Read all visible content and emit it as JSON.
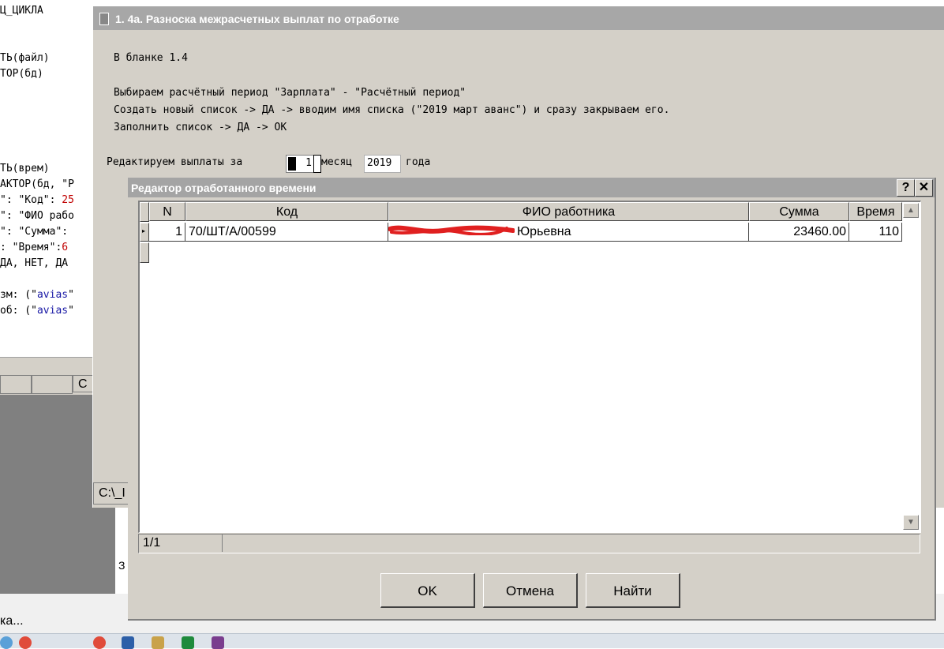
{
  "background_editor": {
    "lines": [
      {
        "text": "Ц_ЦИКЛА"
      },
      {
        "text": "ТЬ(файл)"
      },
      {
        "text": "ТОР(бд)"
      },
      {
        "text": "ТЬ(врем)"
      },
      {
        "text": "АКТОР(бд, \"Р"
      },
      {
        "text": "\": \"Код\": ",
        "red": "25"
      },
      {
        "text": "\": \"ФИО рабо"
      },
      {
        "text": "\": \"Сумма\":"
      },
      {
        "text": ": \"Время\":",
        "red": "6"
      },
      {
        "text": "ДА, НЕТ, ДА"
      },
      {
        "text": "зм: (\"",
        "blue": "avias",
        "tail": "\""
      },
      {
        "text": "об: (\"",
        "blue": "avias",
        "tail": "\""
      }
    ],
    "toolbar_label": "С",
    "panel_fragment": "З"
  },
  "status_text": "ка...",
  "outer_dialog": {
    "title": "1. 4а. Разноска межрасчетных выплат по отработке",
    "instructions": [
      "В бланке 1.4",
      "Выбираем расчётный период \"Зарплата\" - \"Расчётный период\"",
      "Создать новый список -> ДА -> вводим имя списка (\"2019 март аванс\") и сразу закрываем его.",
      "Заполнить список -> ДА -> ОК"
    ],
    "edit_prefix": "Редактируем выплаты за",
    "month_value": "1",
    "month_label": "месяц",
    "year_value": "2019",
    "year_label": "года",
    "status_path": "C:\\_I"
  },
  "inner_dialog": {
    "title": "Редактор отработанного времени",
    "help_button": "?",
    "close_button": "✕",
    "columns": [
      "N",
      "Код",
      "ФИО работника",
      "Сумма",
      "Время"
    ],
    "rows": [
      {
        "n": "1",
        "code": "70/ШТ/А/00599",
        "name": "Юрьевна",
        "sum": "23460.00",
        "time": "110"
      }
    ],
    "record_counter": "1/1",
    "buttons": {
      "ok": "OK",
      "cancel": "Отмена",
      "find": "Найти"
    }
  },
  "colors": {
    "dialog_face": "#d4d0c8",
    "titlebar_inactive": "#a7a7a7",
    "redaction": "#e02020"
  }
}
